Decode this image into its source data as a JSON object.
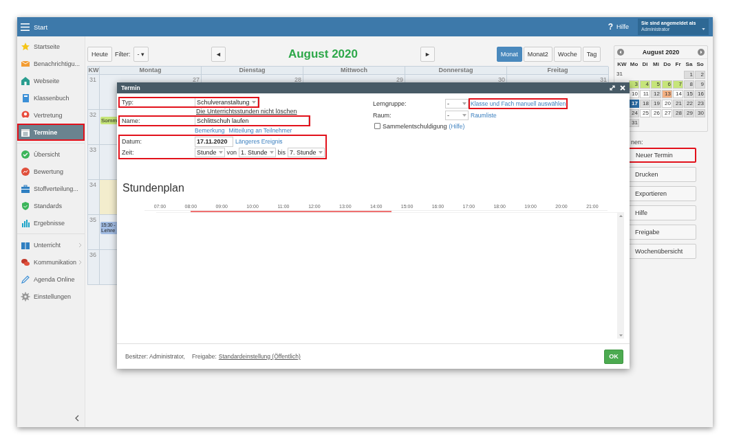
{
  "topbar": {
    "title": "Start",
    "help_icon": "?",
    "help": "Hilfe",
    "user_caption": "Sie sind angemeldet als",
    "user_name": "Administrator"
  },
  "sidebar": {
    "groups": [
      {
        "items": [
          {
            "label": "Startseite",
            "selected": false,
            "highlighted": false,
            "submenu": false
          },
          {
            "label": "Benachrichtigu...",
            "selected": false,
            "highlighted": false,
            "submenu": false
          },
          {
            "label": "Webseite",
            "selected": false,
            "highlighted": false,
            "submenu": false
          },
          {
            "label": "Klassenbuch",
            "selected": false,
            "highlighted": false,
            "submenu": false
          },
          {
            "label": "Vertretung",
            "selected": false,
            "highlighted": false,
            "submenu": false
          },
          {
            "label": "Termine",
            "selected": true,
            "highlighted": true,
            "submenu": false
          }
        ]
      },
      {
        "items": [
          {
            "label": "Übersicht",
            "selected": false,
            "highlighted": false,
            "submenu": false
          },
          {
            "label": "Bewertung",
            "selected": false,
            "highlighted": false,
            "submenu": false
          },
          {
            "label": "Stoffverteilung...",
            "selected": false,
            "highlighted": false,
            "submenu": false
          },
          {
            "label": "Standards",
            "selected": false,
            "highlighted": false,
            "submenu": false
          },
          {
            "label": "Ergebnisse",
            "selected": false,
            "highlighted": false,
            "submenu": false
          }
        ]
      },
      {
        "items": [
          {
            "label": "Unterricht",
            "selected": false,
            "highlighted": false,
            "submenu": true
          },
          {
            "label": "Kommunikation",
            "selected": false,
            "highlighted": false,
            "submenu": true
          },
          {
            "label": "Agenda Online",
            "selected": false,
            "highlighted": false,
            "submenu": false
          },
          {
            "label": "Einstellungen",
            "selected": false,
            "highlighted": false,
            "submenu": false
          }
        ]
      }
    ]
  },
  "calendar": {
    "today_button": "Heute",
    "filter_label": "Filter:",
    "filter_value": "- ▾",
    "prev": "◄",
    "title": "August 2020",
    "next": "►",
    "views": [
      {
        "label": "Monat",
        "selected": true
      },
      {
        "label": "Monat2",
        "selected": false
      },
      {
        "label": "Woche",
        "selected": false
      },
      {
        "label": "Tag",
        "selected": false
      }
    ],
    "columns": [
      "KW",
      "Montag",
      "Dienstag",
      "Mittwoch",
      "Donnerstag",
      "Freitag"
    ],
    "weeks": [
      {
        "kw": "31",
        "dates": [
          "27",
          "28",
          "29",
          "30",
          "31"
        ],
        "shaded": false
      },
      {
        "kw": "32",
        "shaded": false,
        "events": [
          {
            "text": "Somm",
            "color": "#c6e57a"
          }
        ]
      },
      {
        "kw": "33",
        "shaded": false
      },
      {
        "kw": "34",
        "shaded": true
      },
      {
        "kw": "35",
        "shaded": false,
        "events": [
          {
            "time": "15:30 -",
            "text": "Lehre",
            "color": "#a2bce3"
          }
        ]
      },
      {
        "kw": "36",
        "shaded": false
      }
    ]
  },
  "mini_calendar": {
    "title": "August 2020",
    "headers": [
      "KW",
      "Mo",
      "Di",
      "Mi",
      "Do",
      "Fr",
      "Sa",
      "So"
    ],
    "weeks": [
      {
        "kw": "31",
        "days": [
          {
            "kind": "empty"
          },
          {
            "kind": "empty"
          },
          {
            "kind": "empty"
          },
          {
            "kind": "empty"
          },
          {
            "kind": "empty"
          },
          {
            "day": "1",
            "color": "#dddddd",
            "selected": false
          },
          {
            "day": "2",
            "color": "#dddddd",
            "selected": false
          }
        ]
      },
      {
        "days": [
          {
            "day": "3",
            "color": "#c6e57a",
            "selected": false
          },
          {
            "day": "4",
            "color": "#c6e57a",
            "selected": false
          },
          {
            "day": "5",
            "color": "#c6e57a",
            "selected": false
          },
          {
            "day": "6",
            "color": "#c6e57a",
            "selected": false
          },
          {
            "day": "7",
            "color": "#c6e57a",
            "selected": false
          },
          {
            "day": "8",
            "color": "#dddddd",
            "selected": false
          },
          {
            "day": "9",
            "color": "#dddddd",
            "selected": false
          }
        ]
      },
      {
        "days": [
          {
            "day": "10",
            "color": "#ffffff",
            "selected": false
          },
          {
            "day": "11",
            "color": "#ffffff",
            "selected": false
          },
          {
            "day": "12",
            "color": "#dddddd",
            "selected": false
          },
          {
            "day": "13",
            "color": "#f4b183",
            "selected": false
          },
          {
            "day": "14",
            "color": "#ffffff",
            "selected": false
          },
          {
            "day": "15",
            "color": "#dddddd",
            "selected": false
          },
          {
            "day": "16",
            "color": "#dddddd",
            "selected": false
          }
        ]
      },
      {
        "days": [
          {
            "day": "17",
            "color": "#2c6ca3",
            "selected": true
          },
          {
            "day": "18",
            "color": "#dddddd",
            "selected": false
          },
          {
            "day": "19",
            "color": "#dddddd",
            "selected": false
          },
          {
            "day": "20",
            "color": "#ffffff",
            "selected": false
          },
          {
            "day": "21",
            "color": "#dddddd",
            "selected": false
          },
          {
            "day": "22",
            "color": "#dddddd",
            "selected": false
          },
          {
            "day": "23",
            "color": "#dddddd",
            "selected": false
          }
        ]
      },
      {
        "days": [
          {
            "day": "24",
            "color": "#dddddd",
            "selected": false
          },
          {
            "day": "25",
            "color": "#ffffff",
            "selected": false
          },
          {
            "day": "26",
            "color": "#ffffff",
            "selected": false
          },
          {
            "day": "27",
            "color": "#ffffff",
            "selected": false
          },
          {
            "day": "28",
            "color": "#dddddd",
            "selected": false
          },
          {
            "day": "29",
            "color": "#dddddd",
            "selected": false
          },
          {
            "day": "30",
            "color": "#dddddd",
            "selected": false
          }
        ]
      },
      {
        "days": [
          {
            "day": "31",
            "color": "#dddddd",
            "selected": false
          }
        ]
      }
    ]
  },
  "actions": {
    "caption": "nen:",
    "buttons": [
      {
        "label": "Neuer Termin",
        "highlighted": true
      },
      {
        "label": "Drucken",
        "highlighted": false
      },
      {
        "label": "Exportieren",
        "highlighted": false
      },
      {
        "label": "Hilfe",
        "highlighted": false
      },
      {
        "label": "Freigabe",
        "highlighted": false
      },
      {
        "label": "Wochenübersicht",
        "highlighted": false
      }
    ]
  },
  "dialog": {
    "title": "Termin",
    "typ": {
      "label": "Typ:",
      "value": "Schulveranstaltung",
      "highlighted": true
    },
    "typ_note": "Die Unterrichtsstunden nicht löschen",
    "name": {
      "label": "Name:",
      "value": "Schlittschuh laufen",
      "highlighted": true
    },
    "name_links": [
      "Bemerkung",
      "Mitteilung an Teilnehmer"
    ],
    "when": {
      "highlighted": true,
      "date_label": "Datum:",
      "date_value": "17.11.2020",
      "date_link": "Längeres Ereignis",
      "time_label": "Zeit:",
      "mode": "Stunde",
      "from_label": "von",
      "from": "1. Stunde",
      "to_label": "bis",
      "to": "7. Stunde"
    },
    "lerngruppe": {
      "label": "Lerngruppe:",
      "value": "-",
      "link": "Klasse und Fach manuell auswählen",
      "link_highlighted": true
    },
    "raum": {
      "label": "Raum:",
      "value": "-",
      "link": "Raumliste"
    },
    "sammel": {
      "label": "Sammelentschuldigung",
      "checked": false,
      "link": "(Hilfe)"
    },
    "schedule": {
      "title": "Stundenplan",
      "slots": [
        {
          "label": "07:00",
          "selected": false
        },
        {
          "label": "08:00",
          "selected": true
        },
        {
          "label": "09:00",
          "selected": true
        },
        {
          "label": "10:00",
          "selected": true
        },
        {
          "label": "11:00",
          "selected": true
        },
        {
          "label": "12:00",
          "selected": true
        },
        {
          "label": "13:00",
          "selected": true
        },
        {
          "label": "14:00",
          "selected": true
        },
        {
          "label": "15:00",
          "selected": false
        },
        {
          "label": "16:00",
          "selected": false
        },
        {
          "label": "17:00",
          "selected": false
        },
        {
          "label": "18:00",
          "selected": false
        },
        {
          "label": "19:00",
          "selected": false
        },
        {
          "label": "20:00",
          "selected": false
        },
        {
          "label": "21:00",
          "selected": false
        }
      ]
    },
    "footer": {
      "owner": "Besitzer: Administrator,",
      "share_label": "Freigabe:",
      "share_link": "Standardeinstellung (Öffentlich)",
      "ok": "OK"
    }
  }
}
